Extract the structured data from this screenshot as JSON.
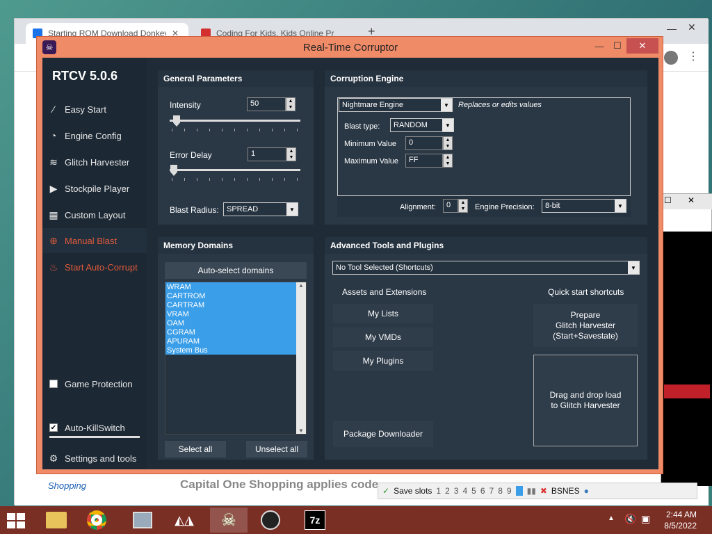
{
  "browser": {
    "tabs": [
      {
        "label": "Starting ROM Download Donkey",
        "close": "✕",
        "active": true
      },
      {
        "label": "Coding For Kids, Kids Online Pro",
        "close": "",
        "active": false
      }
    ],
    "new_tab": "+",
    "page_text": {
      "shopping": "Shopping",
      "capital_one": "Capital One Shopping applies code"
    }
  },
  "emulator": {
    "save_slots_label": "Save slots",
    "slots": [
      "1",
      "2",
      "3",
      "4",
      "5",
      "6",
      "7",
      "8",
      "9"
    ],
    "bsnes_label": "BSNES"
  },
  "window": {
    "title": "Real-Time Corruptor",
    "minimize": "—",
    "maximize": "☐",
    "close": "✕"
  },
  "sidebar": {
    "version": "RTCV 5.0.6",
    "items": [
      {
        "label": "Easy Start",
        "icon": "wand-icon"
      },
      {
        "label": "Engine Config",
        "icon": "gauge-icon"
      },
      {
        "label": "Glitch Harvester",
        "icon": "layers-icon"
      },
      {
        "label": "Stockpile Player",
        "icon": "play-icon"
      },
      {
        "label": "Custom Layout",
        "icon": "grid-icon"
      },
      {
        "label": "Manual Blast",
        "icon": "crosshair-icon"
      },
      {
        "label": "Start Auto-Corrupt",
        "icon": "fire-icon"
      }
    ],
    "game_protection": "Game Protection",
    "auto_killswitch": "Auto-KillSwitch",
    "settings": "Settings and tools"
  },
  "general": {
    "header": "General Parameters",
    "intensity_label": "Intensity",
    "intensity_value": "50",
    "error_delay_label": "Error Delay",
    "error_delay_value": "1",
    "blast_radius_label": "Blast Radius:",
    "blast_radius_value": "SPREAD"
  },
  "engine": {
    "header": "Corruption Engine",
    "engine_value": "Nightmare Engine",
    "engine_desc": "Replaces or edits values",
    "blast_type_label": "Blast type:",
    "blast_type_value": "RANDOM",
    "min_label": "Minimum Value",
    "min_value": "0",
    "max_label": "Maximum Value",
    "max_value": "FF",
    "alignment_label": "Alignment:",
    "alignment_value": "0",
    "precision_label": "Engine Precision:",
    "precision_value": "8-bit"
  },
  "memory": {
    "header": "Memory Domains",
    "auto_select": "Auto-select domains",
    "domains": [
      "WRAM",
      "CARTROM",
      "CARTRAM",
      "VRAM",
      "OAM",
      "CGRAM",
      "APURAM",
      "System Bus"
    ],
    "select_all": "Select all",
    "unselect_all": "Unselect all"
  },
  "advanced": {
    "header": "Advanced Tools and Plugins",
    "tool_select": "No Tool Selected (Shortcuts)",
    "assets_header": "Assets and Extensions",
    "my_lists": "My Lists",
    "my_vmds": "My VMDs",
    "my_plugins": "My Plugins",
    "package_downloader": "Package Downloader",
    "quick_header": "Quick start shortcuts",
    "prepare": "Prepare\nGlitch Harvester\n(Start+Savestate)",
    "drag_drop": "Drag and drop load\nto Glitch Harvester"
  },
  "taskbar": {
    "time": "2:44 AM",
    "date": "8/5/2022"
  },
  "colors": {
    "title_bar": "#f08b68",
    "client_bg": "#1f2c38",
    "accent_red": "#e25a3a",
    "selection_blue": "#3a9ee8",
    "taskbar": "#7a2f25"
  }
}
